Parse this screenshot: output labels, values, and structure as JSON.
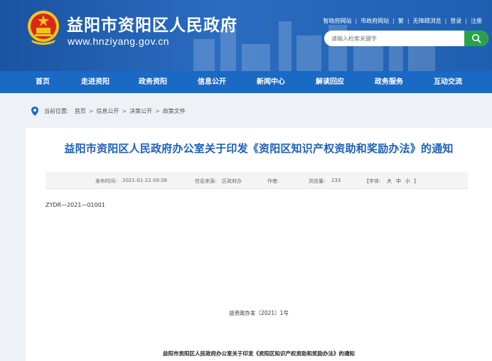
{
  "header": {
    "site_title": "益阳市资阳区人民政府",
    "site_url": "www.hnziyang.gov.cn",
    "top_links": [
      "智政府网站",
      "市政府网站",
      "繁",
      "无障碍浏览",
      "登录",
      "注册"
    ],
    "search_placeholder": "请输入检索关键字"
  },
  "nav": {
    "items": [
      "首页",
      "走进资阳",
      "政务资阳",
      "信息公开",
      "新闻中心",
      "解读回应",
      "政务服务",
      "互动交流"
    ]
  },
  "breadcrumb": {
    "label": "当前位置:",
    "items": [
      "首页",
      "信息公开",
      "决策公开",
      "政策文件"
    ]
  },
  "article": {
    "title": "益阳市资阳区人民政府办公室关于印发《资阳区知识产权资助和奖励办法》的通知",
    "meta": {
      "publish_label": "发布时间:",
      "publish_time": "2021-01-22 09:38",
      "source_label": "信息来源:",
      "source": "区政府办",
      "author_label": "作者:",
      "author": "",
      "views_label": "浏览量:",
      "views": "233",
      "font_label": "【字体:",
      "font_large": "大",
      "font_medium": "中",
      "font_small": "小",
      "font_close": "】"
    },
    "doc_number": "ZYDR—2021—01001",
    "file_number": "益资政办发〔2021〕1号",
    "subtitle": "益阳市资阳区人民政府办公室关于印发《资阳区知识产权资助和奖励办法》的通知"
  },
  "colors": {
    "header_blue": "#1a54a2",
    "nav_blue": "#1a69c4",
    "title_blue": "#1c5fb8",
    "search_green": "#2aa24a"
  }
}
